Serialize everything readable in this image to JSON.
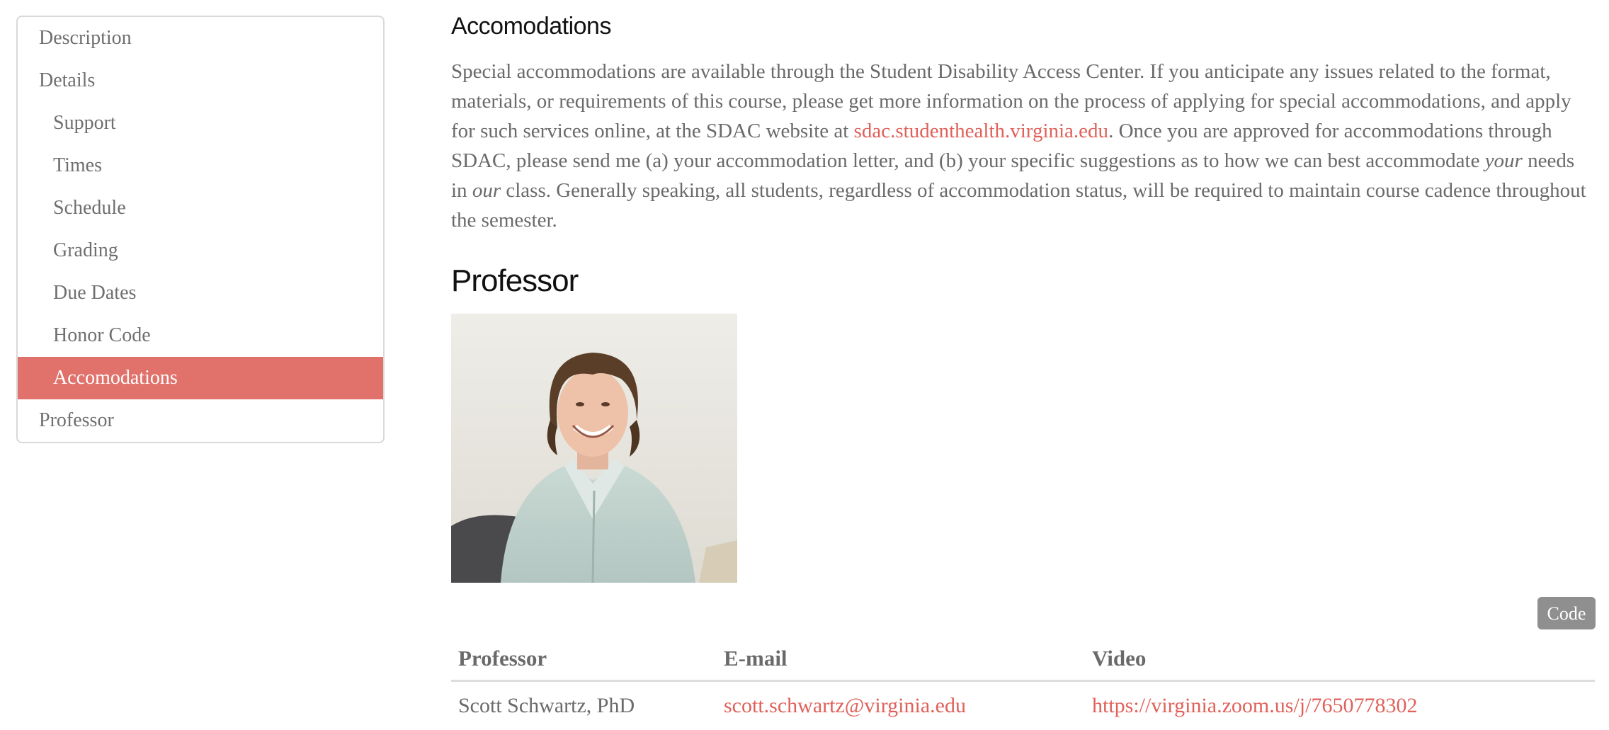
{
  "sidebar": {
    "items": [
      {
        "label": "Description",
        "level": 0,
        "active": false
      },
      {
        "label": "Details",
        "level": 0,
        "active": false
      },
      {
        "label": "Support",
        "level": 1,
        "active": false
      },
      {
        "label": "Times",
        "level": 1,
        "active": false
      },
      {
        "label": "Schedule",
        "level": 1,
        "active": false
      },
      {
        "label": "Grading",
        "level": 1,
        "active": false
      },
      {
        "label": "Due Dates",
        "level": 1,
        "active": false
      },
      {
        "label": "Honor Code",
        "level": 1,
        "active": false
      },
      {
        "label": "Accomodations",
        "level": 1,
        "active": true
      },
      {
        "label": "Professor",
        "level": 0,
        "active": false
      }
    ],
    "active_color": "#e0716b"
  },
  "accommodations": {
    "heading": "Accomodations",
    "text_1": "Special accommodations are available through the Student Disability Access Center. If you anticipate any issues related to the format, materials, or requirements of this course, please get more information on the process of applying for special accommodations, and apply for such services online, at the SDAC website at ",
    "link": "sdac.studenthealth.virginia.edu",
    "text_2": ". Once you are approved for accommodations through SDAC, please send me (a) your accommodation letter, and (b) your specific suggestions as to how we can best accommodate ",
    "em_1": "your",
    "text_3": " needs in ",
    "em_2": "our",
    "text_4": " class. Generally speaking, all students, regardless of accommodation status, will be required to maintain course cadence throughout the semester."
  },
  "professor": {
    "heading": "Professor",
    "code_button": "Code",
    "table": {
      "headers": [
        "Professor",
        "E-mail",
        "Video"
      ],
      "rows": [
        {
          "name": "Scott Schwartz, PhD",
          "email": "scott.schwartz@virginia.edu",
          "video": "https://virginia.zoom.us/j/7650778302"
        }
      ]
    }
  },
  "colors": {
    "link": "#e0615a",
    "accent": "#e0716b"
  }
}
